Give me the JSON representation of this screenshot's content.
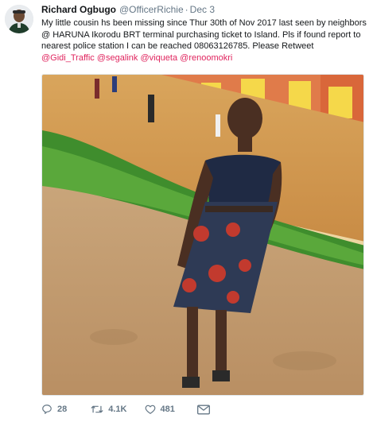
{
  "tweet": {
    "author_name": "Richard Ogbugo",
    "author_handle": "@OfficerRichie",
    "separator": "·",
    "date": "Dec 3",
    "text_1": "My little cousin hs been missing since Thur 30th of Nov 2017 last seen by neighbors @ HARUNA Ikorodu BRT  terminal purchasing ticket to Island. Pls if found report to nearest police station I can be reached 08063126785. Please Retweet ",
    "mentions": [
      "@Gidi_Traffic",
      "@segalink",
      "@viqueta",
      "@renoomokri"
    ]
  },
  "actions": {
    "reply_count": "28",
    "retweet_count": "4.1K",
    "like_count": "481"
  },
  "icons": {
    "reply": "reply-icon",
    "retweet": "retweet-icon",
    "like": "heart-icon",
    "dm": "envelope-icon"
  },
  "colors": {
    "mention": "#e0245e",
    "meta": "#657786",
    "text": "#14171a"
  }
}
